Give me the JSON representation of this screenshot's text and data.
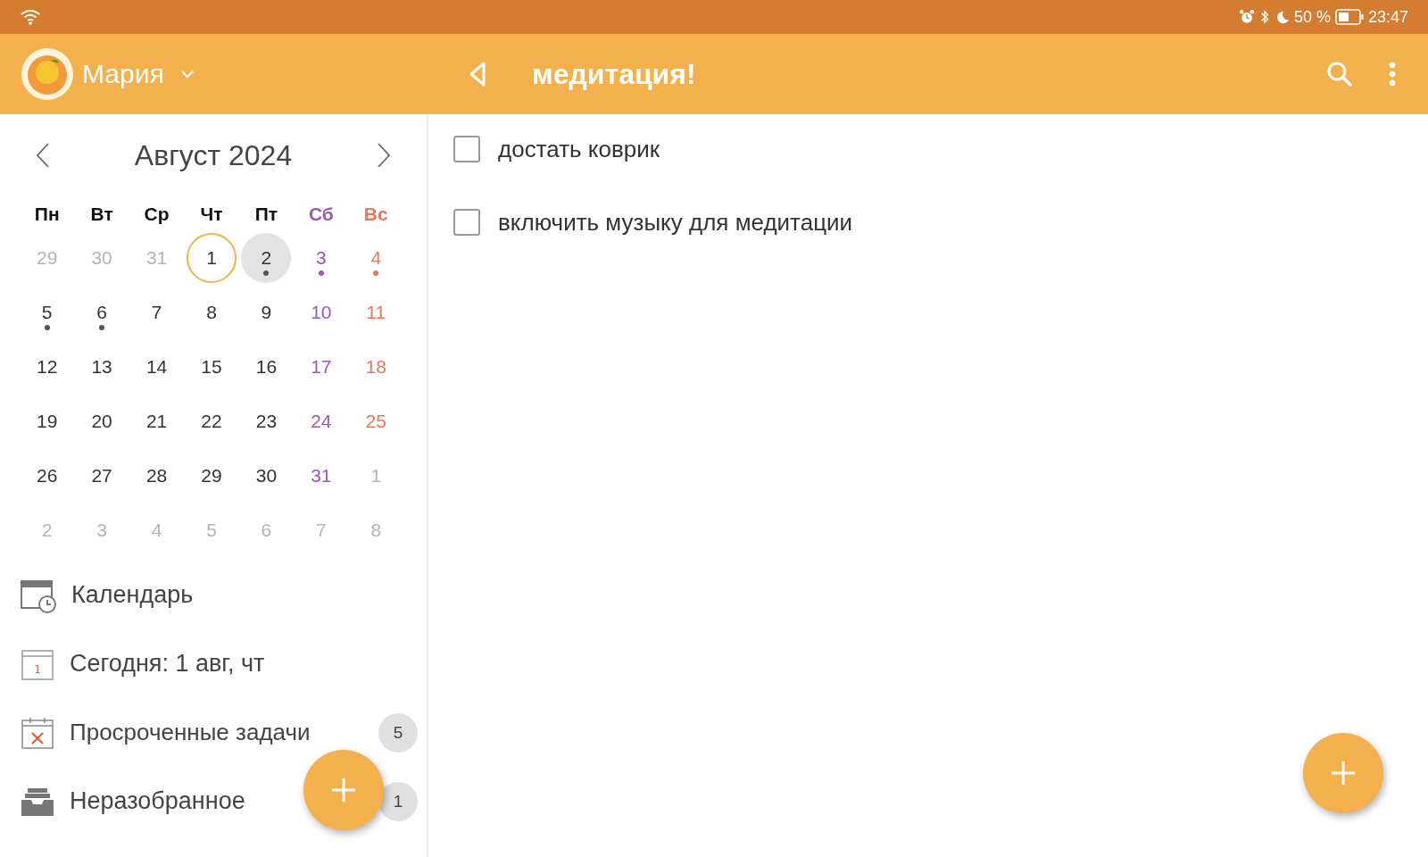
{
  "status_bar": {
    "time": "23:47",
    "battery": "50 %"
  },
  "app_bar": {
    "user": "Мария",
    "title": "медитация!"
  },
  "calendar": {
    "month": "Август 2024",
    "weekdays": [
      {
        "label": "Пн",
        "kind": "weekday"
      },
      {
        "label": "Вт",
        "kind": "weekday"
      },
      {
        "label": "Ср",
        "kind": "weekday"
      },
      {
        "label": "Чт",
        "kind": "weekday"
      },
      {
        "label": "Пт",
        "kind": "weekday"
      },
      {
        "label": "Сб",
        "kind": "saturday"
      },
      {
        "label": "Вс",
        "kind": "sunday"
      }
    ],
    "days": [
      {
        "label": "29",
        "kind": "muted",
        "today": false,
        "selected": false,
        "has_tasks": false
      },
      {
        "label": "30",
        "kind": "muted",
        "today": false,
        "selected": false,
        "has_tasks": false
      },
      {
        "label": "31",
        "kind": "muted",
        "today": false,
        "selected": false,
        "has_tasks": false
      },
      {
        "label": "1",
        "kind": "weekday",
        "today": true,
        "selected": false,
        "has_tasks": false
      },
      {
        "label": "2",
        "kind": "weekday",
        "today": false,
        "selected": true,
        "has_tasks": true
      },
      {
        "label": "3",
        "kind": "saturday",
        "today": false,
        "selected": false,
        "has_tasks": true
      },
      {
        "label": "4",
        "kind": "sunday",
        "today": false,
        "selected": false,
        "has_tasks": true
      },
      {
        "label": "5",
        "kind": "weekday",
        "today": false,
        "selected": false,
        "has_tasks": true
      },
      {
        "label": "6",
        "kind": "weekday",
        "today": false,
        "selected": false,
        "has_tasks": true
      },
      {
        "label": "7",
        "kind": "weekday",
        "today": false,
        "selected": false,
        "has_tasks": false
      },
      {
        "label": "8",
        "kind": "weekday",
        "today": false,
        "selected": false,
        "has_tasks": false
      },
      {
        "label": "9",
        "kind": "weekday",
        "today": false,
        "selected": false,
        "has_tasks": false
      },
      {
        "label": "10",
        "kind": "saturday",
        "today": false,
        "selected": false,
        "has_tasks": false
      },
      {
        "label": "11",
        "kind": "sunday",
        "today": false,
        "selected": false,
        "has_tasks": false
      },
      {
        "label": "12",
        "kind": "weekday",
        "today": false,
        "selected": false,
        "has_tasks": false
      },
      {
        "label": "13",
        "kind": "weekday",
        "today": false,
        "selected": false,
        "has_tasks": false
      },
      {
        "label": "14",
        "kind": "weekday",
        "today": false,
        "selected": false,
        "has_tasks": false
      },
      {
        "label": "15",
        "kind": "weekday",
        "today": false,
        "selected": false,
        "has_tasks": false
      },
      {
        "label": "16",
        "kind": "weekday",
        "today": false,
        "selected": false,
        "has_tasks": false
      },
      {
        "label": "17",
        "kind": "saturday",
        "today": false,
        "selected": false,
        "has_tasks": false
      },
      {
        "label": "18",
        "kind": "sunday",
        "today": false,
        "selected": false,
        "has_tasks": false
      },
      {
        "label": "19",
        "kind": "weekday",
        "today": false,
        "selected": false,
        "has_tasks": false
      },
      {
        "label": "20",
        "kind": "weekday",
        "today": false,
        "selected": false,
        "has_tasks": false
      },
      {
        "label": "21",
        "kind": "weekday",
        "today": false,
        "selected": false,
        "has_tasks": false
      },
      {
        "label": "22",
        "kind": "weekday",
        "today": false,
        "selected": false,
        "has_tasks": false
      },
      {
        "label": "23",
        "kind": "weekday",
        "today": false,
        "selected": false,
        "has_tasks": false
      },
      {
        "label": "24",
        "kind": "saturday",
        "today": false,
        "selected": false,
        "has_tasks": false
      },
      {
        "label": "25",
        "kind": "sunday",
        "today": false,
        "selected": false,
        "has_tasks": false
      },
      {
        "label": "26",
        "kind": "weekday",
        "today": false,
        "selected": false,
        "has_tasks": false
      },
      {
        "label": "27",
        "kind": "weekday",
        "today": false,
        "selected": false,
        "has_tasks": false
      },
      {
        "label": "28",
        "kind": "weekday",
        "today": false,
        "selected": false,
        "has_tasks": false
      },
      {
        "label": "29",
        "kind": "weekday",
        "today": false,
        "selected": false,
        "has_tasks": false
      },
      {
        "label": "30",
        "kind": "weekday",
        "today": false,
        "selected": false,
        "has_tasks": false
      },
      {
        "label": "31",
        "kind": "saturday",
        "today": false,
        "selected": false,
        "has_tasks": false
      },
      {
        "label": "1",
        "kind": "muted",
        "today": false,
        "selected": false,
        "has_tasks": false
      },
      {
        "label": "2",
        "kind": "muted",
        "today": false,
        "selected": false,
        "has_tasks": false
      },
      {
        "label": "3",
        "kind": "muted",
        "today": false,
        "selected": false,
        "has_tasks": false
      },
      {
        "label": "4",
        "kind": "muted",
        "today": false,
        "selected": false,
        "has_tasks": false
      },
      {
        "label": "5",
        "kind": "muted",
        "today": false,
        "selected": false,
        "has_tasks": false
      },
      {
        "label": "6",
        "kind": "muted",
        "today": false,
        "selected": false,
        "has_tasks": false
      },
      {
        "label": "7",
        "kind": "muted",
        "today": false,
        "selected": false,
        "has_tasks": false
      },
      {
        "label": "8",
        "kind": "muted",
        "today": false,
        "selected": false,
        "has_tasks": false
      }
    ]
  },
  "sidebar": {
    "items": [
      {
        "label": "Календарь",
        "kind": "calendar"
      },
      {
        "label": "Сегодня: 1 авг, чт",
        "kind": "today",
        "icon_day": "1"
      },
      {
        "label": "Просроченные задачи",
        "kind": "overdue",
        "count": "5"
      },
      {
        "label": "Неразобранное",
        "kind": "inbox",
        "count": "1"
      }
    ]
  },
  "tasks": [
    {
      "label": "достать коврик",
      "checked": false
    },
    {
      "label": "включить музыку для медитации",
      "checked": false
    }
  ]
}
